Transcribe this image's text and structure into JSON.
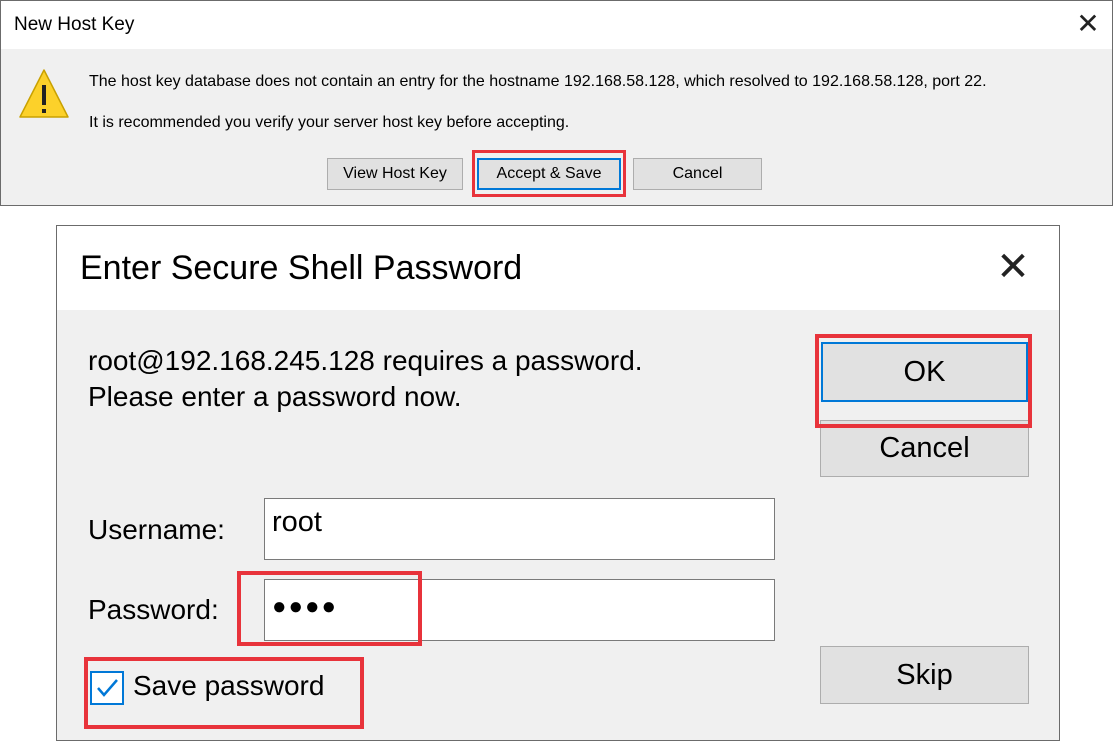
{
  "host_key_dialog": {
    "title": "New Host Key",
    "message_line1": "The host key database does not contain an entry for the hostname 192.168.58.128, which resolved to 192.168.58.128, port 22.",
    "message_line2": "It is recommended you verify your server host key before accepting.",
    "buttons": {
      "view_host_key": "View Host Key",
      "accept_save": "Accept & Save",
      "cancel": "Cancel"
    },
    "icons": {
      "close": "close-icon",
      "warning": "warning-icon"
    }
  },
  "password_dialog": {
    "title": "Enter Secure Shell Password",
    "prompt_line1": "root@192.168.245.128 requires a password.",
    "prompt_line2": "Please enter a password now.",
    "username_label": "Username:",
    "username_value": "root",
    "password_label": "Password:",
    "password_value": "●●●●",
    "save_password_label": "Save password",
    "save_password_checked": true,
    "buttons": {
      "ok": "OK",
      "cancel": "Cancel",
      "skip": "Skip"
    },
    "icons": {
      "close": "close-icon",
      "checkmark": "checkmark-icon"
    }
  },
  "colors": {
    "highlight": "#e8333b",
    "focus": "#0078d7",
    "dialog_bg": "#f0f0f0",
    "button_bg": "#e1e1e1",
    "warning": "#fcd12a"
  }
}
